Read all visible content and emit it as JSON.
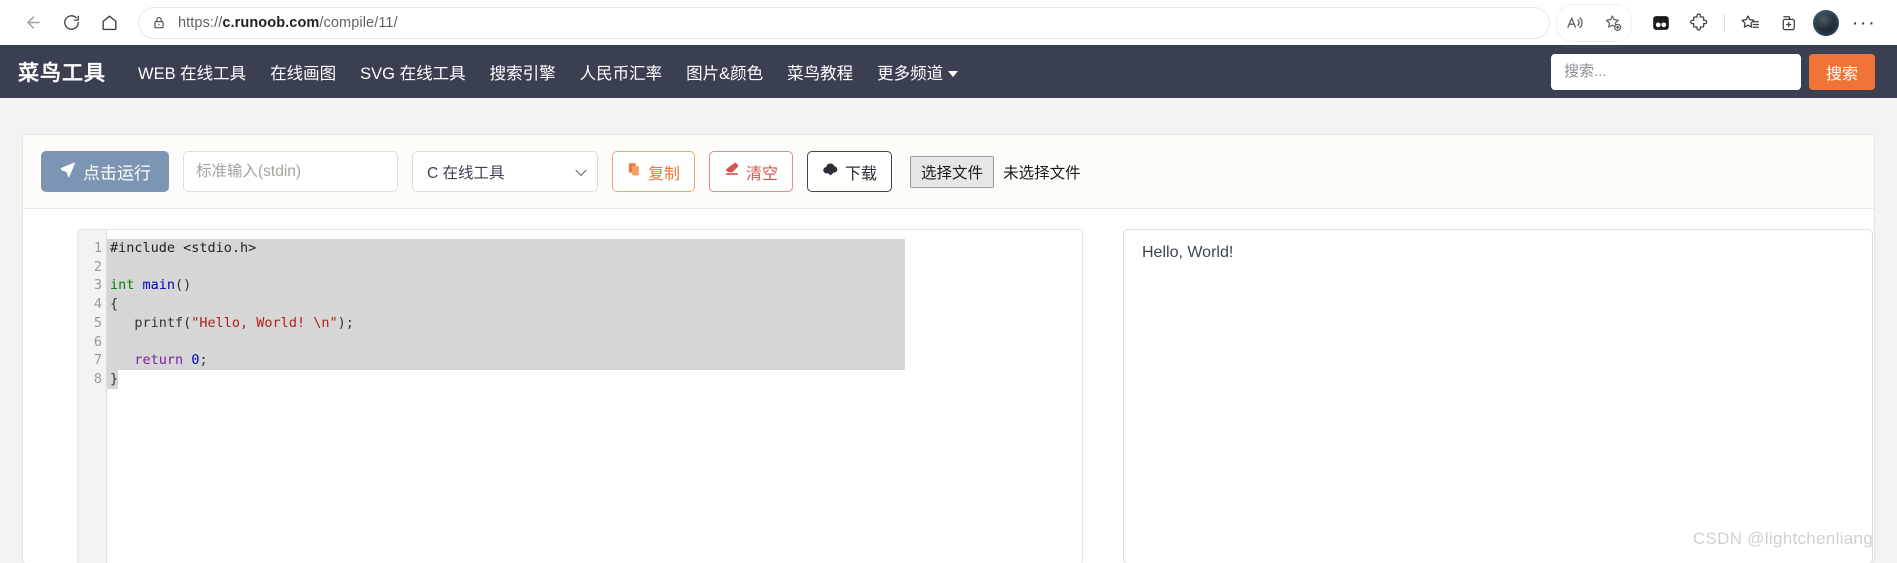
{
  "browser": {
    "back_icon": "back-arrow-icon",
    "reload_icon": "reload-icon",
    "home_icon": "home-icon",
    "lock_icon": "lock-icon",
    "url_prefix": "https://",
    "url_domain": "c.runoob.com",
    "url_path": "/compile/11/",
    "url_full": "https://c.runoob.com/compile/11/",
    "read_aloud_icon": "read-aloud-icon",
    "add_favorite_icon": "add-favorite-star-icon",
    "split_screen_icon": "split-screen-icon",
    "extensions_icon": "extensions-puzzle-icon",
    "favorites_icon": "favorites-list-icon",
    "collections_icon": "collections-add-icon",
    "profile_icon": "profile-avatar-icon",
    "settings_icon": "more-options-ellipsis-icon"
  },
  "site_nav": {
    "logo": "菜鸟工具",
    "items": [
      {
        "label": "WEB 在线工具",
        "has_caret": false
      },
      {
        "label": "在线画图",
        "has_caret": false
      },
      {
        "label": "SVG 在线工具",
        "has_caret": false
      },
      {
        "label": "搜索引擎",
        "has_caret": false
      },
      {
        "label": "人民币汇率",
        "has_caret": false
      },
      {
        "label": "图片&颜色",
        "has_caret": false
      },
      {
        "label": "菜鸟教程",
        "has_caret": false
      },
      {
        "label": "更多频道",
        "has_caret": true
      }
    ],
    "search_placeholder": "搜索...",
    "search_value": "",
    "search_button": "搜索",
    "bar_color": "#3a4051",
    "search_button_color": "#f07438"
  },
  "toolbar": {
    "run_label": "点击运行",
    "run_icon": "paper-plane-icon",
    "run_color": "#7c95b2",
    "stdin_placeholder": "标准输入(stdin)",
    "stdin_value": "",
    "language_selected": "C 在线工具",
    "language_caret_icon": "chevron-down-icon",
    "copy_label": "复制",
    "copy_icon": "copy-clipboard-icon",
    "copy_color": "#f07438",
    "clear_label": "清空",
    "clear_icon": "eraser-icon",
    "clear_color": "#d9534f",
    "download_label": "下载",
    "download_icon": "cloud-download-icon",
    "download_color": "#2b2f38",
    "file_button": "选择文件",
    "file_status": "未选择文件"
  },
  "editor": {
    "line_numbers": [
      "1",
      "2",
      "3",
      "4",
      "5",
      "6",
      "7",
      "8"
    ],
    "lines": [
      {
        "n": "1",
        "tokens": [
          {
            "t": "#include <stdio.h>",
            "c": "t-pre"
          }
        ]
      },
      {
        "n": "2",
        "tokens": [
          {
            "t": "",
            "c": "t-punc"
          }
        ]
      },
      {
        "n": "3",
        "tokens": [
          {
            "t": "int ",
            "c": "t-type"
          },
          {
            "t": "main",
            "c": "t-fn"
          },
          {
            "t": "()",
            "c": "t-punc"
          }
        ]
      },
      {
        "n": "4",
        "tokens": [
          {
            "t": "{",
            "c": "t-punc"
          }
        ]
      },
      {
        "n": "5",
        "tokens": [
          {
            "t": "   printf(",
            "c": "t-punc"
          },
          {
            "t": "\"Hello, World! \\n\"",
            "c": "t-str"
          },
          {
            "t": ");",
            "c": "t-punc"
          }
        ]
      },
      {
        "n": "6",
        "tokens": [
          {
            "t": "",
            "c": "t-punc"
          }
        ]
      },
      {
        "n": "7",
        "tokens": [
          {
            "t": "   ",
            "c": "t-punc"
          },
          {
            "t": "return",
            "c": "t-kw"
          },
          {
            "t": " ",
            "c": "t-punc"
          },
          {
            "t": "0",
            "c": "t-num"
          },
          {
            "t": ";",
            "c": "t-punc"
          }
        ]
      },
      {
        "n": "8",
        "tokens": [
          {
            "t": "}",
            "c": "t-punc"
          }
        ]
      }
    ],
    "plain_code": "#include <stdio.h>\n\nint main()\n{\n   printf(\"Hello, World! \\n\");\n\n   return 0;\n}",
    "selection_highlight": true
  },
  "output": {
    "text": "Hello, World!"
  },
  "watermark": {
    "text": "CSDN @lightchenliang"
  }
}
